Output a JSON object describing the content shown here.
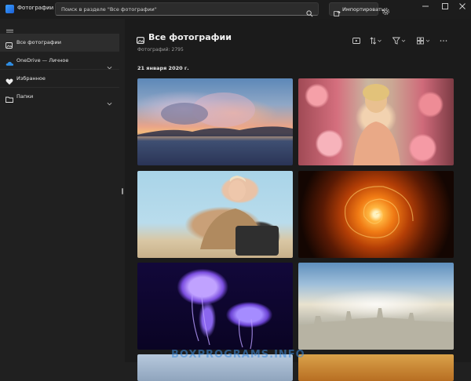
{
  "titlebar": {
    "app_title": "Фотографии",
    "search_placeholder": "Поиск в разделе \"Все фотографии\"",
    "import_label": "Импортировать"
  },
  "sidebar": {
    "items": [
      {
        "label": "Все фотографии",
        "icon": "photos-icon",
        "selected": true
      },
      {
        "label": "OneDrive — Личное",
        "icon": "onedrive-cloud-icon",
        "expandable": true
      },
      {
        "label": "Избранное",
        "icon": "heart-icon"
      },
      {
        "label": "Папки",
        "icon": "folder-icon",
        "expandable": true
      }
    ]
  },
  "main": {
    "title": "Все фотографии",
    "photo_count": "Фотографий: 2795",
    "date_header": "21 января 2020 г.",
    "toolbar": [
      "slideshow-icon",
      "sort-icon",
      "filter-icon",
      "view-size-icon",
      "more-icon"
    ],
    "photos": [
      {
        "name": "sunset-sea"
      },
      {
        "name": "woman-flowers"
      },
      {
        "name": "woman-sitting"
      },
      {
        "name": "orange-spiral"
      },
      {
        "name": "purple-jellyfish"
      },
      {
        "name": "city-haze"
      }
    ]
  },
  "watermark": "BOXPROGRAMS.INFO",
  "colors": {
    "accent": "#3aa0ff",
    "background": "#202020",
    "content": "#1b1b1b"
  }
}
